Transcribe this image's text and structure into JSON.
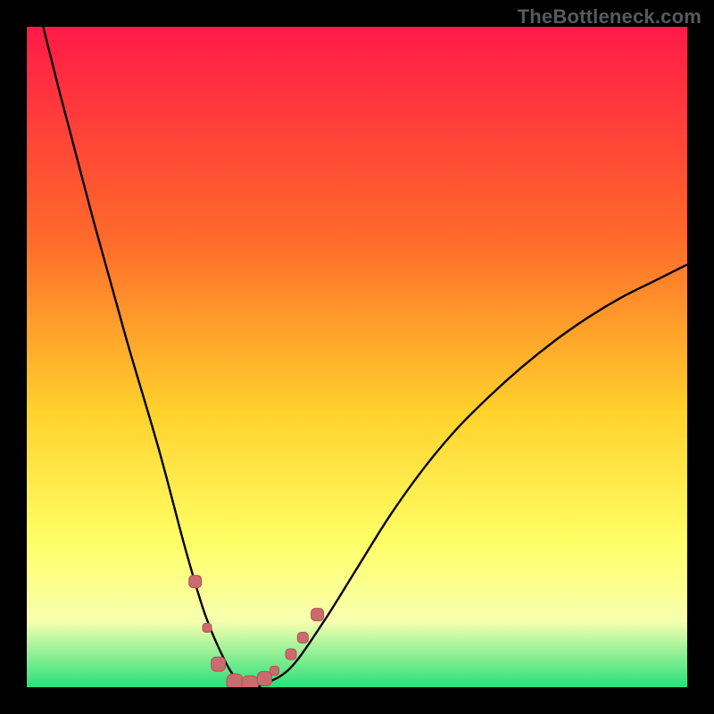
{
  "watermark": "TheBottleneck.com",
  "colors": {
    "bg": "#000000",
    "grad_top": "#ff1a47",
    "grad_mid1": "#ff6a2a",
    "grad_mid2": "#ffd12b",
    "grad_mid3": "#ffff66",
    "grad_low": "#f7ffb0",
    "grad_bottom": "#28e07a",
    "curve": "#000000",
    "marker_fill": "#cc6b6e",
    "marker_stroke": "#b35154"
  },
  "chart_data": {
    "type": "line",
    "title": "",
    "xlabel": "",
    "ylabel": "",
    "xlim": [
      0,
      100
    ],
    "ylim": [
      0,
      100
    ],
    "series": [
      {
        "name": "bottleneck-curve",
        "x": [
          0,
          5,
          10,
          15,
          20,
          24,
          27,
          30,
          32,
          34,
          36,
          40,
          45,
          50,
          55,
          60,
          65,
          70,
          75,
          80,
          85,
          90,
          95,
          100
        ],
        "values": [
          110,
          90,
          71,
          53,
          36,
          21,
          11,
          4,
          1,
          0,
          0.5,
          3,
          10,
          18,
          26,
          33,
          39,
          44,
          48.5,
          52.5,
          56,
          59,
          61.5,
          64
        ]
      }
    ],
    "markers": [
      {
        "x": 25.5,
        "y": 16,
        "size": 14
      },
      {
        "x": 27.3,
        "y": 9,
        "size": 10
      },
      {
        "x": 29.0,
        "y": 3.5,
        "size": 16
      },
      {
        "x": 31.5,
        "y": 0.8,
        "size": 18
      },
      {
        "x": 33.8,
        "y": 0.5,
        "size": 18
      },
      {
        "x": 36.0,
        "y": 1.3,
        "size": 16
      },
      {
        "x": 37.5,
        "y": 2.5,
        "size": 10
      },
      {
        "x": 40.0,
        "y": 5.0,
        "size": 12
      },
      {
        "x": 41.8,
        "y": 7.5,
        "size": 12
      },
      {
        "x": 44.0,
        "y": 11.0,
        "size": 14
      }
    ]
  }
}
